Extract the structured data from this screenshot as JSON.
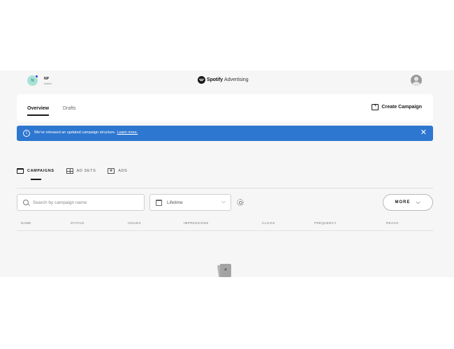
{
  "header": {
    "user_initial": "N",
    "user_name": "NP",
    "user_role": "Admin",
    "brand_name": "Spotify",
    "brand_sub": "Advertising"
  },
  "nav": {
    "tabs": [
      {
        "label": "Overview",
        "active": true
      },
      {
        "label": "Drafts",
        "active": false
      }
    ],
    "create_label": "Create Campaign"
  },
  "banner": {
    "text": "We've released an updated campaign structure.",
    "link": "Learn more.",
    "color": "#2e77d0"
  },
  "levels": [
    {
      "label": "CAMPAIGNS",
      "icon": "folder-icon",
      "active": true
    },
    {
      "label": "AD SETS",
      "icon": "grid-icon",
      "active": false
    },
    {
      "label": "ADS",
      "icon": "star-icon",
      "active": false
    }
  ],
  "controls": {
    "search_placeholder": "Search by campaign name",
    "date_value": "Lifetime",
    "more_label": "MORE"
  },
  "table": {
    "columns": [
      "NAME",
      "STATUS",
      "ISSUES",
      "IMPRESSIONS",
      "CLICKS",
      "FREQUENCY",
      "REACH"
    ]
  }
}
